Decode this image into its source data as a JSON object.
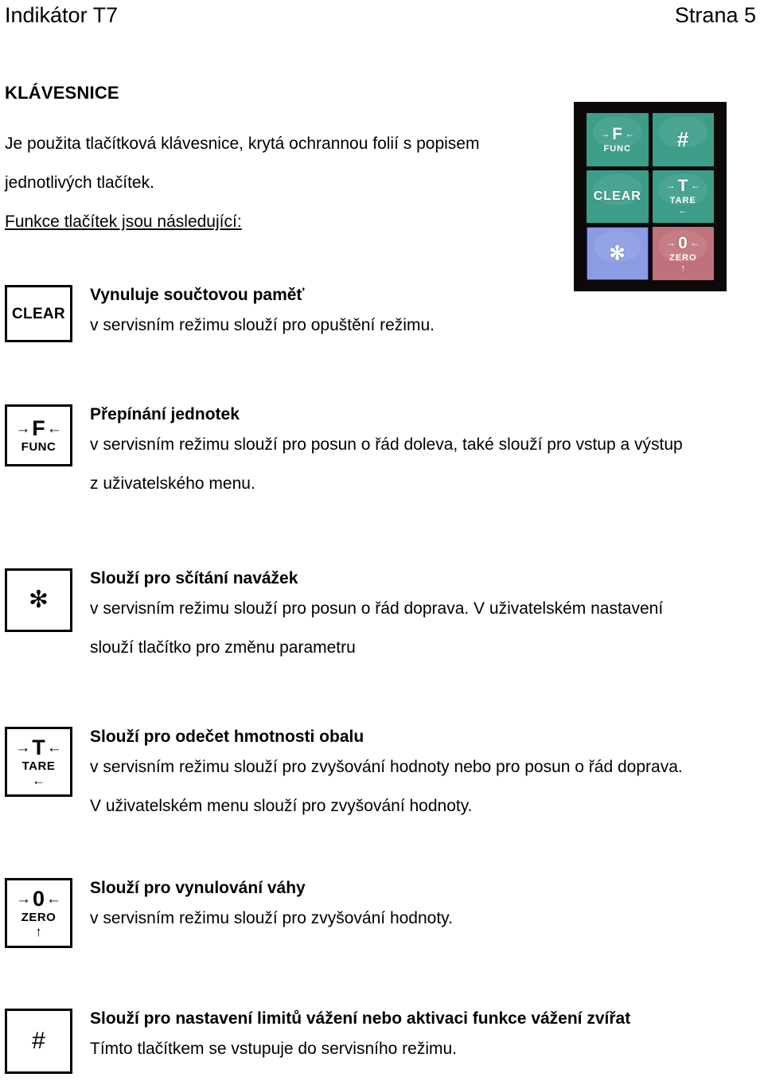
{
  "header": {
    "document_title": "Indikátor T7",
    "page_label": "Strana 5"
  },
  "section": {
    "title": "KLÁVESNICE",
    "intro_line1": "Je použita tlačítková klávesnice, krytá ochrannou folií s popisem",
    "intro_line2": "jednotlivých tlačítek.",
    "intro_line3_underlined": "Funkce tlačítek jsou následující:"
  },
  "keypad_photo": {
    "alt": "keypad-photo",
    "colors": {
      "bezel": "#0d0908",
      "green": "#3c9d89",
      "blue": "#8b9ce2",
      "red": "#c0727c"
    },
    "keys": [
      {
        "name": "func",
        "main": "F",
        "sub": "FUNC",
        "left_arrow": "→",
        "right_arrow": "←",
        "color": "green"
      },
      {
        "name": "hash",
        "main": "#",
        "sub": "",
        "color": "green"
      },
      {
        "name": "clear",
        "main": "CLEAR",
        "sub": "",
        "color": "green"
      },
      {
        "name": "tare",
        "main": "T",
        "sub": "TARE",
        "sub2": "←",
        "left_arrow": "→",
        "right_arrow": "←",
        "color": "green"
      },
      {
        "name": "asterisk",
        "main": "✻",
        "sub": "",
        "color": "blue"
      },
      {
        "name": "zero",
        "main": "0",
        "sub": "ZERO",
        "sub2": "↑",
        "left_arrow": "→",
        "right_arrow": "←",
        "color": "red"
      }
    ]
  },
  "entries": [
    {
      "icon": {
        "kind": "word",
        "word": "CLEAR"
      },
      "heading": "Vynuluje součtovou paměť",
      "body_lines": [
        "v servisním režimu slouží pro opuštění režimu."
      ]
    },
    {
      "icon": {
        "kind": "letter-arrows",
        "letter": "F",
        "sub": "FUNC",
        "left_arrow": "→",
        "right_arrow": "←"
      },
      "heading": "Přepínání jednotek",
      "body_lines": [
        "v servisním režimu slouží pro posun o řád doleva, také slouží pro vstup a výstup",
        "z uživatelského menu."
      ]
    },
    {
      "icon": {
        "kind": "symbol",
        "symbol": "✻"
      },
      "heading": "Slouží pro sčítání navážek",
      "body_lines": [
        "v servisním režimu slouží pro posun o řád doprava. V uživatelském nastavení",
        "slouží tlačítko pro změnu parametru"
      ]
    },
    {
      "icon": {
        "kind": "letter-arrows",
        "letter": "T",
        "sub": "TARE",
        "sub2": "←",
        "left_arrow": "→",
        "right_arrow": "←"
      },
      "heading": "Slouží pro odečet hmotnosti obalu",
      "body_lines": [
        "v servisním režimu slouží pro zvyšování hodnoty nebo pro posun o řád doprava.",
        "V uživatelském menu slouží pro zvyšování hodnoty."
      ]
    },
    {
      "icon": {
        "kind": "letter-arrows",
        "letter": "0",
        "sub": "ZERO",
        "sub2": "↑",
        "left_arrow": "→",
        "right_arrow": "←"
      },
      "heading": "Slouží pro vynulování váhy",
      "body_lines": [
        "v servisním režimu slouží pro zvyšování hodnoty."
      ]
    },
    {
      "icon": {
        "kind": "symbol",
        "symbol": "#"
      },
      "heading": "Slouží pro nastavení limitů vážení nebo aktivaci funkce vážení zvířat",
      "body_lines": [
        "Tímto tlačítkem se vstupuje do servisního režimu."
      ]
    }
  ]
}
